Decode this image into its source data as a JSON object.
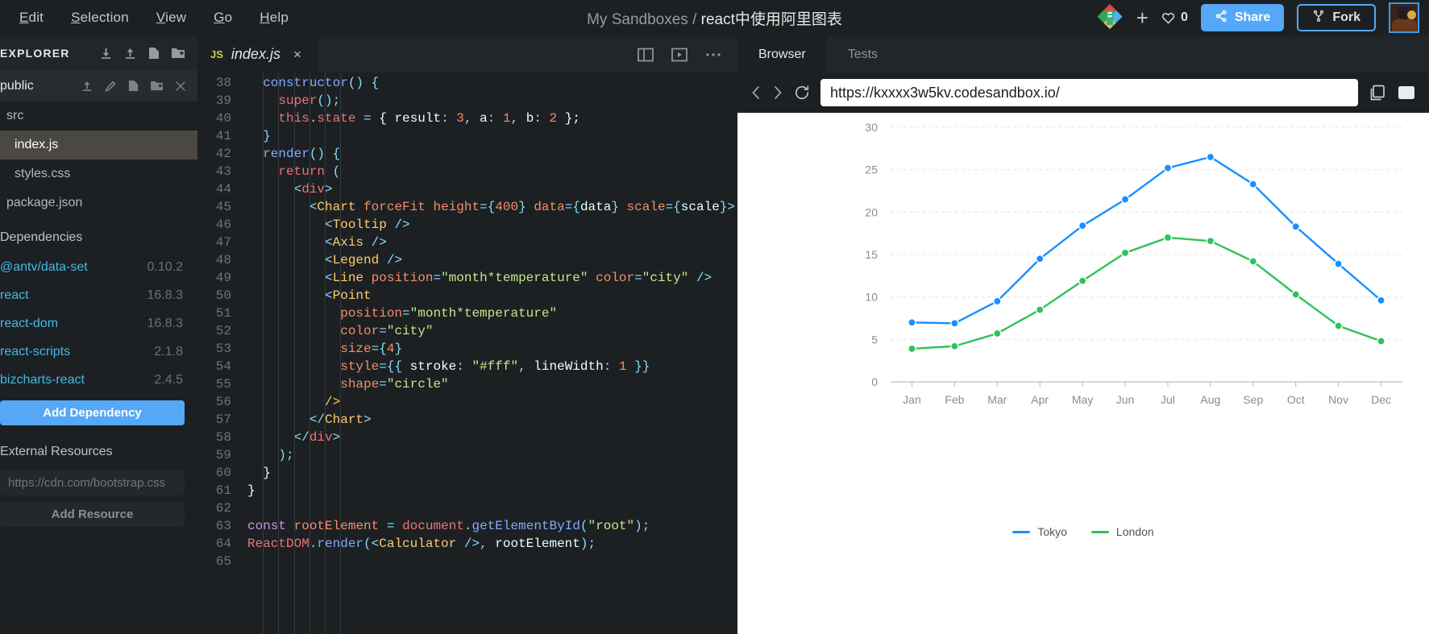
{
  "menu": {
    "items": [
      {
        "mnemonic": "E",
        "rest": "dit",
        "name": "edit"
      },
      {
        "mnemonic": "S",
        "rest": "election",
        "name": "selection"
      },
      {
        "mnemonic": "V",
        "rest": "iew",
        "name": "view"
      },
      {
        "mnemonic": "G",
        "rest": "o",
        "name": "go"
      },
      {
        "mnemonic": "H",
        "rest": "elp",
        "name": "help"
      }
    ]
  },
  "header": {
    "workspace": "My Sandboxes",
    "separator": " / ",
    "sandbox_name": "react中使用阿里图表",
    "like_count": "0",
    "share_label": "Share",
    "fork_label": "Fork"
  },
  "sidebar": {
    "explorer_label": "EXPLORER",
    "directory": "public",
    "files": [
      {
        "label": "src",
        "active": false,
        "indent": 1
      },
      {
        "label": "index.js",
        "active": true,
        "indent": 2
      },
      {
        "label": "styles.css",
        "active": false,
        "indent": 2
      },
      {
        "label": "package.json",
        "active": false,
        "indent": 1
      }
    ],
    "dependencies_label": "Dependencies",
    "dependencies": [
      {
        "name": "@antv/data-set",
        "version": "0.10.2"
      },
      {
        "name": "react",
        "version": "16.8.3"
      },
      {
        "name": "react-dom",
        "version": "16.8.3"
      },
      {
        "name": "react-scripts",
        "version": "2.1.8"
      },
      {
        "name": "bizcharts-react",
        "version": "2.4.5"
      }
    ],
    "add_dependency_label": "Add Dependency",
    "external_resources_label": "External Resources",
    "resource_placeholder": "https://cdn.com/bootstrap.css",
    "add_resource_label": "Add Resource"
  },
  "editor": {
    "tab": {
      "badge": "JS",
      "filename": "index.js",
      "close": "×"
    },
    "first_line_number": 38,
    "lines": [
      {
        "n": 38,
        "tokens": [
          {
            "t": "  ",
            "c": "plain"
          },
          {
            "t": "constructor",
            "c": "fn"
          },
          {
            "t": "() {",
            "c": "punc"
          }
        ]
      },
      {
        "n": 39,
        "tokens": [
          {
            "t": "    ",
            "c": "plain"
          },
          {
            "t": "super",
            "c": "prop"
          },
          {
            "t": "();",
            "c": "punc"
          }
        ]
      },
      {
        "n": 40,
        "tokens": [
          {
            "t": "    ",
            "c": "plain"
          },
          {
            "t": "this",
            "c": "prop"
          },
          {
            "t": ".",
            "c": "punc"
          },
          {
            "t": "state",
            "c": "prop"
          },
          {
            "t": " = ",
            "c": "punc"
          },
          {
            "t": "{ ",
            "c": "var"
          },
          {
            "t": "result",
            "c": "var"
          },
          {
            "t": ": ",
            "c": "punc"
          },
          {
            "t": "3",
            "c": "num"
          },
          {
            "t": ", ",
            "c": "punc"
          },
          {
            "t": "a",
            "c": "var"
          },
          {
            "t": ": ",
            "c": "punc"
          },
          {
            "t": "1",
            "c": "num"
          },
          {
            "t": ", ",
            "c": "punc"
          },
          {
            "t": "b",
            "c": "var"
          },
          {
            "t": ": ",
            "c": "punc"
          },
          {
            "t": "2",
            "c": "num"
          },
          {
            "t": " };",
            "c": "var"
          }
        ]
      },
      {
        "n": 41,
        "tokens": [
          {
            "t": "  }",
            "c": "punc"
          }
        ]
      },
      {
        "n": 42,
        "tokens": [
          {
            "t": "  ",
            "c": "plain"
          },
          {
            "t": "render",
            "c": "fn"
          },
          {
            "t": "() {",
            "c": "punc"
          }
        ]
      },
      {
        "n": 43,
        "tokens": [
          {
            "t": "    ",
            "c": "plain"
          },
          {
            "t": "return",
            "c": "prop"
          },
          {
            "t": " (",
            "c": "punc"
          }
        ]
      },
      {
        "n": 44,
        "tokens": [
          {
            "t": "      ",
            "c": "plain"
          },
          {
            "t": "<",
            "c": "punc"
          },
          {
            "t": "div",
            "c": "tag-htm"
          },
          {
            "t": ">",
            "c": "punc"
          }
        ]
      },
      {
        "n": 45,
        "tokens": [
          {
            "t": "        ",
            "c": "plain"
          },
          {
            "t": "<",
            "c": "punc"
          },
          {
            "t": "Chart",
            "c": "tag"
          },
          {
            "t": " ",
            "c": "plain"
          },
          {
            "t": "forceFit",
            "c": "attr"
          },
          {
            "t": " ",
            "c": "plain"
          },
          {
            "t": "height",
            "c": "attr"
          },
          {
            "t": "=",
            "c": "punc"
          },
          {
            "t": "{",
            "c": "punc"
          },
          {
            "t": "400",
            "c": "num"
          },
          {
            "t": "} ",
            "c": "punc"
          },
          {
            "t": "data",
            "c": "attr"
          },
          {
            "t": "=",
            "c": "punc"
          },
          {
            "t": "{",
            "c": "punc"
          },
          {
            "t": "data",
            "c": "var"
          },
          {
            "t": "} ",
            "c": "punc"
          },
          {
            "t": "scale",
            "c": "attr"
          },
          {
            "t": "=",
            "c": "punc"
          },
          {
            "t": "{",
            "c": "punc"
          },
          {
            "t": "scale",
            "c": "var"
          },
          {
            "t": "}>",
            "c": "punc"
          }
        ]
      },
      {
        "n": 46,
        "tokens": [
          {
            "t": "          ",
            "c": "plain"
          },
          {
            "t": "<",
            "c": "punc"
          },
          {
            "t": "Tooltip",
            "c": "tag"
          },
          {
            "t": " />",
            "c": "punc"
          }
        ]
      },
      {
        "n": 47,
        "tokens": [
          {
            "t": "          ",
            "c": "plain"
          },
          {
            "t": "<",
            "c": "punc"
          },
          {
            "t": "Axis",
            "c": "tag"
          },
          {
            "t": " />",
            "c": "punc"
          }
        ]
      },
      {
        "n": 48,
        "tokens": [
          {
            "t": "          ",
            "c": "plain"
          },
          {
            "t": "<",
            "c": "punc"
          },
          {
            "t": "Legend",
            "c": "tag"
          },
          {
            "t": " />",
            "c": "punc"
          }
        ]
      },
      {
        "n": 49,
        "tokens": [
          {
            "t": "          ",
            "c": "plain"
          },
          {
            "t": "<",
            "c": "punc"
          },
          {
            "t": "Line",
            "c": "tag"
          },
          {
            "t": " ",
            "c": "plain"
          },
          {
            "t": "position",
            "c": "attr"
          },
          {
            "t": "=",
            "c": "punc"
          },
          {
            "t": "\"month*temperature\"",
            "c": "str"
          },
          {
            "t": " ",
            "c": "plain"
          },
          {
            "t": "color",
            "c": "attr"
          },
          {
            "t": "=",
            "c": "punc"
          },
          {
            "t": "\"city\"",
            "c": "str"
          },
          {
            "t": " />",
            "c": "punc"
          }
        ]
      },
      {
        "n": 50,
        "tokens": [
          {
            "t": "          ",
            "c": "plain"
          },
          {
            "t": "<",
            "c": "punc"
          },
          {
            "t": "Point",
            "c": "tag"
          }
        ]
      },
      {
        "n": 51,
        "tokens": [
          {
            "t": "            ",
            "c": "plain"
          },
          {
            "t": "position",
            "c": "attr"
          },
          {
            "t": "=",
            "c": "punc"
          },
          {
            "t": "\"month*temperature\"",
            "c": "str"
          }
        ]
      },
      {
        "n": 52,
        "tokens": [
          {
            "t": "            ",
            "c": "plain"
          },
          {
            "t": "color",
            "c": "attr"
          },
          {
            "t": "=",
            "c": "punc"
          },
          {
            "t": "\"city\"",
            "c": "str"
          }
        ]
      },
      {
        "n": 53,
        "tokens": [
          {
            "t": "            ",
            "c": "plain"
          },
          {
            "t": "size",
            "c": "attr"
          },
          {
            "t": "=",
            "c": "punc"
          },
          {
            "t": "{",
            "c": "punc"
          },
          {
            "t": "4",
            "c": "num"
          },
          {
            "t": "}",
            "c": "punc"
          }
        ]
      },
      {
        "n": 54,
        "tokens": [
          {
            "t": "            ",
            "c": "plain"
          },
          {
            "t": "style",
            "c": "attr"
          },
          {
            "t": "=",
            "c": "punc"
          },
          {
            "t": "{{ ",
            "c": "punc"
          },
          {
            "t": "stroke",
            "c": "var"
          },
          {
            "t": ": ",
            "c": "punc"
          },
          {
            "t": "\"#fff\"",
            "c": "str"
          },
          {
            "t": ", ",
            "c": "punc"
          },
          {
            "t": "lineWidth",
            "c": "var"
          },
          {
            "t": ": ",
            "c": "punc"
          },
          {
            "t": "1",
            "c": "num"
          },
          {
            "t": " }}",
            "c": "punc"
          }
        ]
      },
      {
        "n": 55,
        "tokens": [
          {
            "t": "            ",
            "c": "plain"
          },
          {
            "t": "shape",
            "c": "attr"
          },
          {
            "t": "=",
            "c": "punc"
          },
          {
            "t": "\"circle\"",
            "c": "str"
          }
        ]
      },
      {
        "n": 56,
        "tokens": [
          {
            "t": "          ",
            "c": "plain"
          },
          {
            "t": "/>",
            "c": "tag"
          }
        ]
      },
      {
        "n": 57,
        "tokens": [
          {
            "t": "        ",
            "c": "plain"
          },
          {
            "t": "</",
            "c": "punc"
          },
          {
            "t": "Chart",
            "c": "tag"
          },
          {
            "t": ">",
            "c": "punc"
          }
        ]
      },
      {
        "n": 58,
        "tokens": [
          {
            "t": "      ",
            "c": "plain"
          },
          {
            "t": "</",
            "c": "punc"
          },
          {
            "t": "div",
            "c": "tag-htm"
          },
          {
            "t": ">",
            "c": "punc"
          }
        ]
      },
      {
        "n": 59,
        "tokens": [
          {
            "t": "    );",
            "c": "punc"
          }
        ]
      },
      {
        "n": 60,
        "tokens": [
          {
            "t": "  }",
            "c": "var"
          }
        ]
      },
      {
        "n": 61,
        "tokens": [
          {
            "t": "}",
            "c": "var"
          }
        ]
      },
      {
        "n": 62,
        "tokens": []
      },
      {
        "n": 63,
        "tokens": [
          {
            "t": "const",
            "c": "kw"
          },
          {
            "t": " ",
            "c": "plain"
          },
          {
            "t": "rootElement",
            "c": "attr"
          },
          {
            "t": " ",
            "c": "plain"
          },
          {
            "t": "=",
            "c": "punc"
          },
          {
            "t": " ",
            "c": "plain"
          },
          {
            "t": "document",
            "c": "prop"
          },
          {
            "t": ".",
            "c": "punc"
          },
          {
            "t": "getElementById",
            "c": "fn"
          },
          {
            "t": "(",
            "c": "punc"
          },
          {
            "t": "\"root\"",
            "c": "str"
          },
          {
            "t": ");",
            "c": "punc"
          }
        ]
      },
      {
        "n": 64,
        "tokens": [
          {
            "t": "ReactDOM",
            "c": "prop"
          },
          {
            "t": ".",
            "c": "punc"
          },
          {
            "t": "render",
            "c": "fn"
          },
          {
            "t": "(<",
            "c": "punc"
          },
          {
            "t": "Calculator",
            "c": "tag"
          },
          {
            "t": " />, ",
            "c": "punc"
          },
          {
            "t": "rootElement",
            "c": "var"
          },
          {
            "t": ");",
            "c": "punc"
          }
        ]
      },
      {
        "n": 65,
        "tokens": []
      }
    ]
  },
  "preview": {
    "tabs": [
      {
        "label": "Browser",
        "active": true
      },
      {
        "label": "Tests",
        "active": false
      }
    ],
    "url": "https://kxxxx3w5kv.codesandbox.io/"
  },
  "chart_data": {
    "type": "line",
    "title": "",
    "xlabel": "",
    "ylabel": "",
    "categories": [
      "Jan",
      "Feb",
      "Mar",
      "Apr",
      "May",
      "Jun",
      "Jul",
      "Aug",
      "Sep",
      "Oct",
      "Nov",
      "Dec"
    ],
    "yticks": [
      0,
      5,
      10,
      15,
      20,
      25,
      30
    ],
    "ylim": [
      0,
      30
    ],
    "grid": true,
    "legend_position": "bottom",
    "series": [
      {
        "name": "Tokyo",
        "color": "#1890FF",
        "values": [
          7.0,
          6.9,
          9.5,
          14.5,
          18.4,
          21.5,
          25.2,
          26.5,
          23.3,
          18.3,
          13.9,
          9.6
        ]
      },
      {
        "name": "London",
        "color": "#2FC25B",
        "values": [
          3.9,
          4.2,
          5.7,
          8.5,
          11.9,
          15.2,
          17.0,
          16.6,
          14.2,
          10.3,
          6.6,
          4.8
        ]
      }
    ]
  }
}
